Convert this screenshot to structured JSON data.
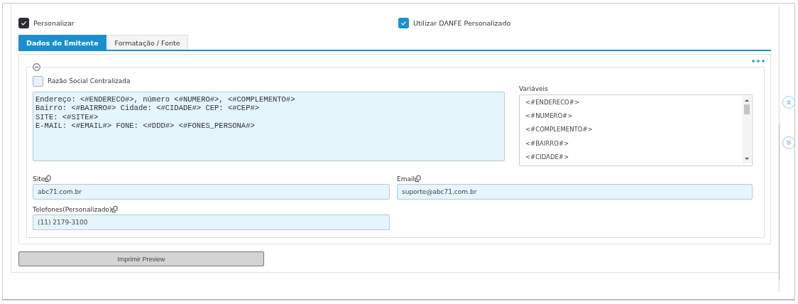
{
  "options": [
    {
      "label": "Personalizar",
      "checked": true,
      "kind": "dark"
    },
    {
      "label": "Utilizar DANFE Personalizado",
      "checked": true,
      "kind": "blue"
    }
  ],
  "tabs": [
    {
      "label": "Dados do Emitente",
      "selected": true
    },
    {
      "label": "Formatação / Fonte",
      "selected": false
    }
  ],
  "section": {
    "expanded": true,
    "razao_social_centralizada": {
      "label": "Razão Social Centralizada",
      "checked": false
    },
    "template": "Endereço: <#ENDERECO#>, número <#NUMERO#>, <#COMPLEMENTO#>\nBairro: <#BAIRRO#> Cidade: <#CIDADE#> CEP: <#CEP#>\nSITE: <#SITE#>\nE-MAIL: <#EMAIL#> FONE: <#DDD#> <#FONES_PERSONA#>",
    "variables_label": "Variáveis",
    "variables": [
      "<#ENDERECO#>",
      "<#NUMERO#>",
      "<#COMPLEMENTO#>",
      "<#BAIRRO#>",
      "<#CIDADE#>"
    ],
    "fields": [
      {
        "label": "Site",
        "value": "abc71.com.br"
      },
      {
        "label": "Email",
        "value": "suporte@abc71.com.br"
      },
      {
        "label": "Telefones(Personalizado)",
        "value": "(11) 2179-3100"
      }
    ]
  },
  "print_button": "Imprimir Preview"
}
